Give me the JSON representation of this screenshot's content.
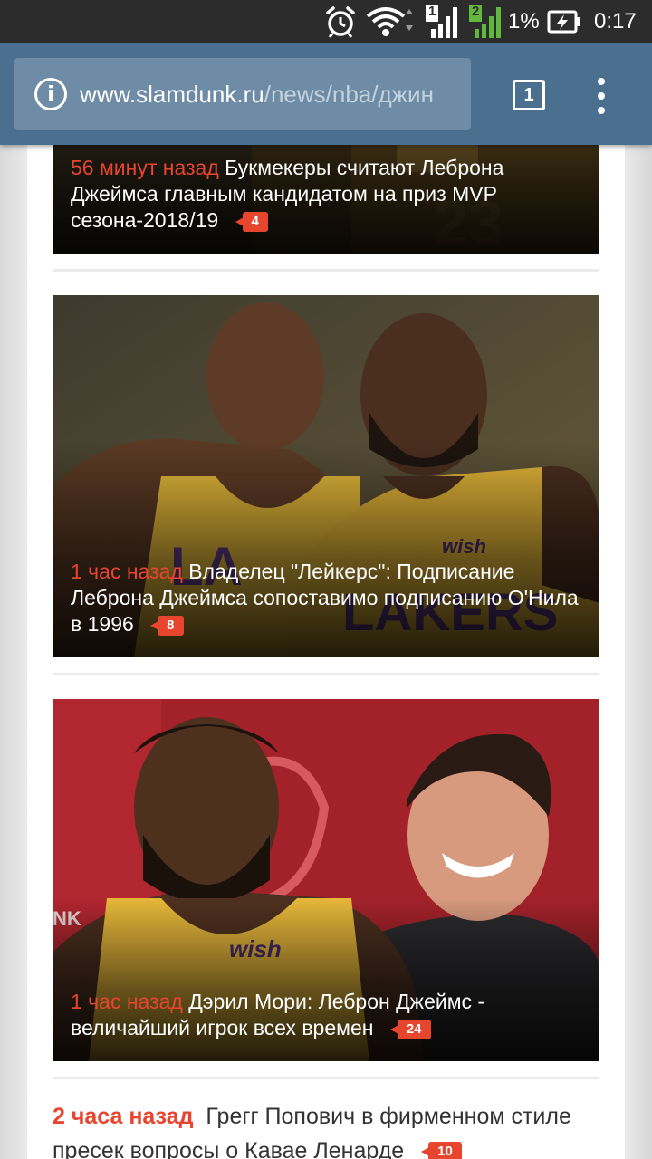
{
  "status_bar": {
    "signal_sim1": "1",
    "signal_sim2": "2",
    "battery": "1%",
    "clock": "0:17",
    "colors": {
      "background": "#2c2c2c",
      "sim2_green": "#62b83c"
    }
  },
  "browser": {
    "url_host": "www.slamdunk.ru",
    "url_path": "/news/nba/джин",
    "tab_count": "1",
    "colors": {
      "toolbar": "#4a6f8f",
      "urlbox": "#6f8ca6"
    }
  },
  "news": [
    {
      "time": "56 минут назад",
      "title": "Букмекеры считают Леброна Джеймса главным кандидатом на приз MVP сезона-2018/19",
      "comments": "4"
    },
    {
      "time": "1 час назад",
      "title": "Владелец \"Лейкерс\": Подписание Леброна Джеймса сопоставимо подписанию О'Нила в 1996",
      "comments": "8"
    },
    {
      "time": "1 час назад",
      "title": "Дэрил Мори: Леброн Джеймс - величайший игрок всех времен",
      "comments": "24"
    },
    {
      "time": "2 часа назад",
      "title": "Грегг Попович в фирменном стиле пресек вопросы о Кавае Ленарде",
      "comments": "10"
    }
  ],
  "accent_color": "#e8452f"
}
